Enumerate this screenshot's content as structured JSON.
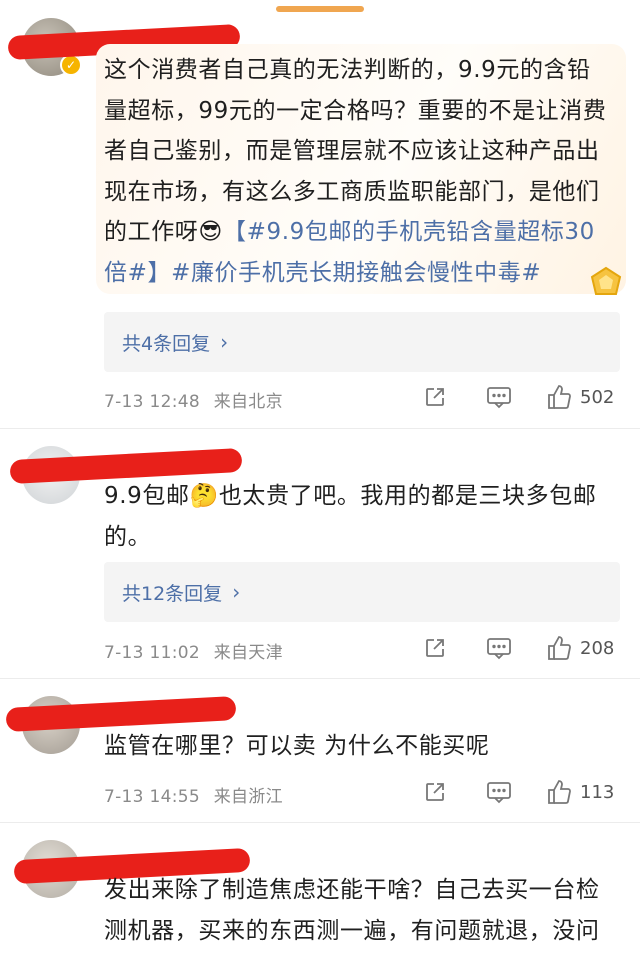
{
  "comments": [
    {
      "text_parts": [
        "这个消费者自己真的无法判断的，9.9元的含铅量超标，99元的一定合格吗？重要的不是让消费者自己鉴别，而是管理层就不应该让这种产品出现在市场，有这么多工商质监职能部门，是他们的工作呀"
      ],
      "emoji": "😎",
      "topic1": "【#9.9包邮的手机壳铅含量超标30倍#】",
      "topic2": "#廉价手机壳长期接触会慢性中毒#",
      "reply_label": "共4条回复",
      "time": "7-13 12:48",
      "location": "来自北京",
      "likes": "502"
    },
    {
      "text_before": "9.9包邮",
      "emoji": "🤔",
      "text_after": "也太贵了吧。我用的都是三块多包邮的。",
      "reply_label": "共12条回复",
      "time": "7-13 11:02",
      "location": "来自天津",
      "likes": "208"
    },
    {
      "text": "监管在哪里？可以卖 为什么不能买呢",
      "time": "7-13 14:55",
      "location": "来自浙江",
      "likes": "113"
    },
    {
      "text": "发出来除了制造焦虑还能干啥？自己去买一台检测机器，买来的东西测一遍，有问题就退，没问"
    }
  ],
  "icons": {
    "reply_chevron": "chevron-right-icon",
    "share": "share-icon",
    "comment": "comment-icon",
    "like": "thumbs-up-icon",
    "verified": "verified-badge-icon",
    "fan_badge": "fan-badge-icon"
  },
  "colors": {
    "topic": "#4d6fa7",
    "redaction": "#e8201a",
    "verified": "#f6b400"
  }
}
